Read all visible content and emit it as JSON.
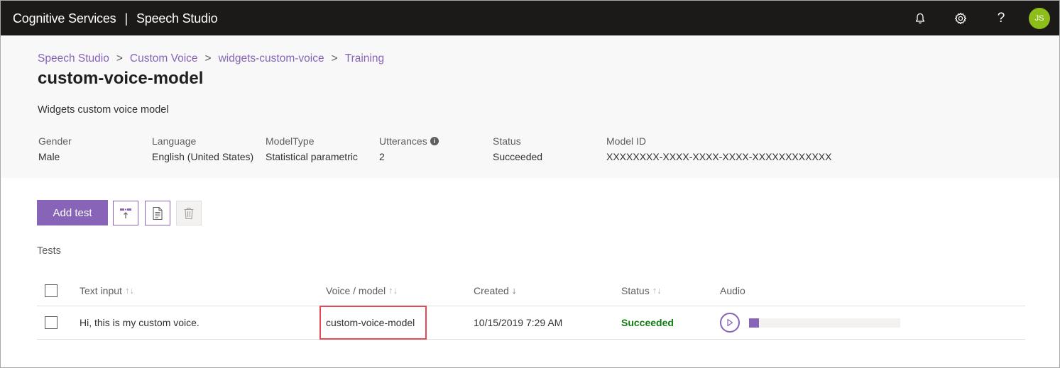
{
  "topbar": {
    "brand": "Cognitive Services",
    "separator": "|",
    "product": "Speech Studio",
    "icons": [
      "bell-icon",
      "gear-icon",
      "help-icon"
    ],
    "help_glyph": "?",
    "avatar_initials": "JS",
    "avatar_color": "#8cbd18"
  },
  "breadcrumb": {
    "items": [
      "Speech Studio",
      "Custom Voice",
      "widgets-custom-voice",
      "Training"
    ],
    "separator": ">"
  },
  "page": {
    "title": "custom-voice-model",
    "description": "Widgets custom voice model"
  },
  "properties": [
    {
      "label": "Gender",
      "value": "Male"
    },
    {
      "label": "Language",
      "value": "English (United States)"
    },
    {
      "label": "ModelType",
      "value": "Statistical parametric"
    },
    {
      "label": "Utterances",
      "value": "2",
      "info_glyph": "i"
    },
    {
      "label": "Status",
      "value": "Succeeded"
    },
    {
      "label": "Model ID",
      "value": "XXXXXXXX-XXXX-XXXX-XXXX-XXXXXXXXXXXX"
    }
  ],
  "toolbar": {
    "add_test_label": "Add test",
    "icons": [
      "upload-icon",
      "document-icon",
      "delete-icon"
    ]
  },
  "tests": {
    "section_label": "Tests",
    "columns": [
      "Text input",
      "Voice / model",
      "Created",
      "Status",
      "Audio"
    ],
    "sort_glyphs": {
      "unsorted": "↑↓",
      "descending": "↓"
    },
    "rows": [
      {
        "text_input": "Hi, this is my custom voice.",
        "voice_model": "custom-voice-model",
        "created": "10/15/2019 7:29 AM",
        "status": "Succeeded",
        "audio_progress": 0.06
      }
    ]
  },
  "colors": {
    "accent": "#8764b8",
    "topbar": "#1b1a19",
    "success": "#107c10",
    "highlight_box": "#e74856"
  }
}
